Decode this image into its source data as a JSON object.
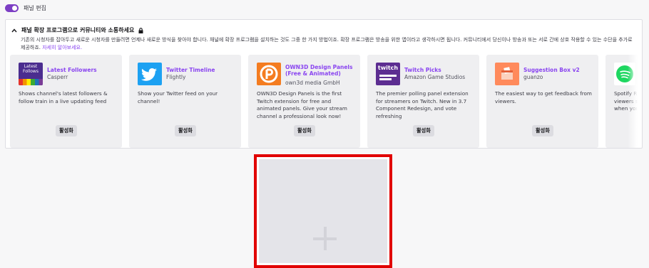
{
  "topbar": {
    "label": "패널 편집",
    "toggle_on": true
  },
  "panel": {
    "title": "패널 확장 프로그램으로 커뮤니티와 소통하세요",
    "description": "기존의 시청자를 잡아두고 새로운 시청자를 만들려면 언제나 새로운 방식을 찾아야 합니다. 채널에 확장 프로그램을 설치하는 것도 그중 한 가지 방법이죠. 확장 프로그램은 방송을 위한 앱이라고 생각하시면 됩니다. 커뮤니티에서 당신이나 방송과 또는 서로 간에 상호 작용할 수 있는 수단을 추가로 제공하죠.",
    "learn_more": "자세히 알아보세요."
  },
  "thumb_texts": {
    "latest_follows": "Latest Follows",
    "twitch": "twitch"
  },
  "extensions": [
    {
      "name": "Latest Followers",
      "author": "Casperr",
      "description": "Shows channel's latest followers & follow train in a live updating feed",
      "button": "활성화",
      "icon": "latest-follows-logo"
    },
    {
      "name": "Twitter Timeline",
      "author": "Flightly",
      "description": "Show your Twitter feed on your channel!",
      "button": "활성화",
      "icon": "twitter-bird-logo"
    },
    {
      "name": "OWN3D Design Panels (Free & Animated)",
      "author": "own3d media GmbH",
      "description": "OWN3D Design Panels is the first Twitch extension for free and animated panels. Give your stream channel a professional look now!",
      "button": "활성화",
      "icon": "own3d-logo"
    },
    {
      "name": "Twitch Picks",
      "author": "Amazon Game Studios",
      "description": "The premier polling panel extension for streamers on Twitch. New in 3.7 Component Redesign, and vote refreshing",
      "button": "활성화",
      "icon": "twitch-picks-logo"
    },
    {
      "name": "Suggestion Box v2",
      "author": "guanzo",
      "description": "The easiest way to get feedback from viewers.",
      "button": "활성화",
      "icon": "suggestion-box-logo"
    },
    {
      "name": "",
      "author": "",
      "description": "Spotify R\nviewers s\nwhen you",
      "button": "",
      "icon": "spotify-logo"
    }
  ],
  "colors": {
    "accent": "#8a45f0",
    "toggle": "#7c3ec4",
    "highlight_border": "#e10000"
  }
}
